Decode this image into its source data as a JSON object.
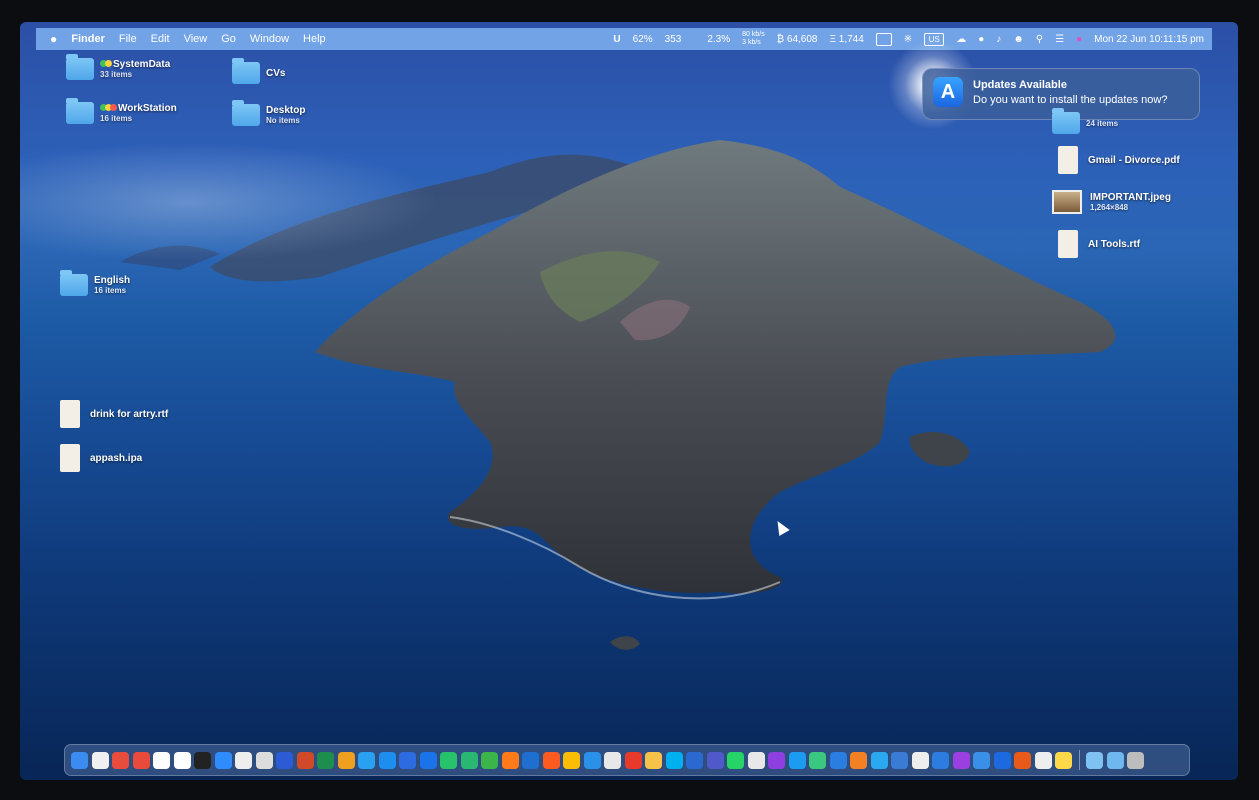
{
  "menubar": {
    "apple": "",
    "items": [
      "Finder",
      "File",
      "Edit",
      "View",
      "Go",
      "Window",
      "Help"
    ],
    "status": {
      "battery": "62%",
      "sync": "353",
      "cpu": "2.3%",
      "network_up": "80 kb/s",
      "network_down": "3 kb/s",
      "btc": "₿ 64,608",
      "eth": "Ξ 1,744",
      "input_source": "US",
      "datetime": "Mon 22 Jun  10:11:15 pm"
    }
  },
  "notification": {
    "title": "Updates Available",
    "message": "Do you want to install the updates now?"
  },
  "desktop": {
    "items": [
      {
        "name": "SystemData",
        "sub": "33 items",
        "kind": "folder",
        "tags": [
          "#3fc35a",
          "#ffd23f"
        ]
      },
      {
        "name": "CVs",
        "sub": "",
        "kind": "folder"
      },
      {
        "name": "WorkStation",
        "sub": "16 items",
        "kind": "folder",
        "tags": [
          "#3fc35a",
          "#ffd23f",
          "#ff5a4f"
        ]
      },
      {
        "name": "Desktop",
        "sub": "No items",
        "kind": "folder"
      },
      {
        "name": "English",
        "sub": "16 items",
        "kind": "folder"
      },
      {
        "name": "drink for artry.rtf",
        "sub": "",
        "kind": "doc"
      },
      {
        "name": "appash.ipa",
        "sub": "",
        "kind": "doc"
      },
      {
        "name": "",
        "sub": "24 items",
        "kind": "folder"
      },
      {
        "name": "Gmail - Divorce.pdf",
        "sub": "",
        "kind": "doc"
      },
      {
        "name": "IMPORTANT.jpeg",
        "sub": "1,264×848",
        "kind": "image"
      },
      {
        "name": "AI Tools.rtf",
        "sub": "",
        "kind": "doc"
      }
    ]
  },
  "dock": {
    "apps": [
      "#3b8cf0",
      "#f0f0f0",
      "#e74c3c",
      "#e84a3c",
      "#ffffff",
      "#ffffff",
      "#222",
      "#2f8cff",
      "#eee",
      "#ddd",
      "#2b5cd6",
      "#d04a2a",
      "#1e8e4e",
      "#f0a020",
      "#2aa0f0",
      "#1d8ef0",
      "#2d6be0",
      "#1a73e8",
      "#27c26c",
      "#2ab673",
      "#3bb54a",
      "#ff7a18",
      "#1f6fd0",
      "#ff5a1f",
      "#fbbc05",
      "#2a90e8",
      "#e8e8e8",
      "#e83a2a",
      "#f7c24a",
      "#00aff0",
      "#2a6ad0",
      "#5059c9",
      "#25d366",
      "#e8e8e8",
      "#8e3fe0",
      "#1b9cf0",
      "#3ac77f",
      "#2a7de1",
      "#f48024",
      "#2aa8f0",
      "#3a7bd5",
      "#eee",
      "#2d7ce0",
      "#9b3fe0",
      "#3a8fe8",
      "#1d6ae0",
      "#e85a1a",
      "#eee",
      "#ffd84a",
      "#7fc2f2",
      "#6fb8ef",
      "#bdbdbd"
    ]
  }
}
